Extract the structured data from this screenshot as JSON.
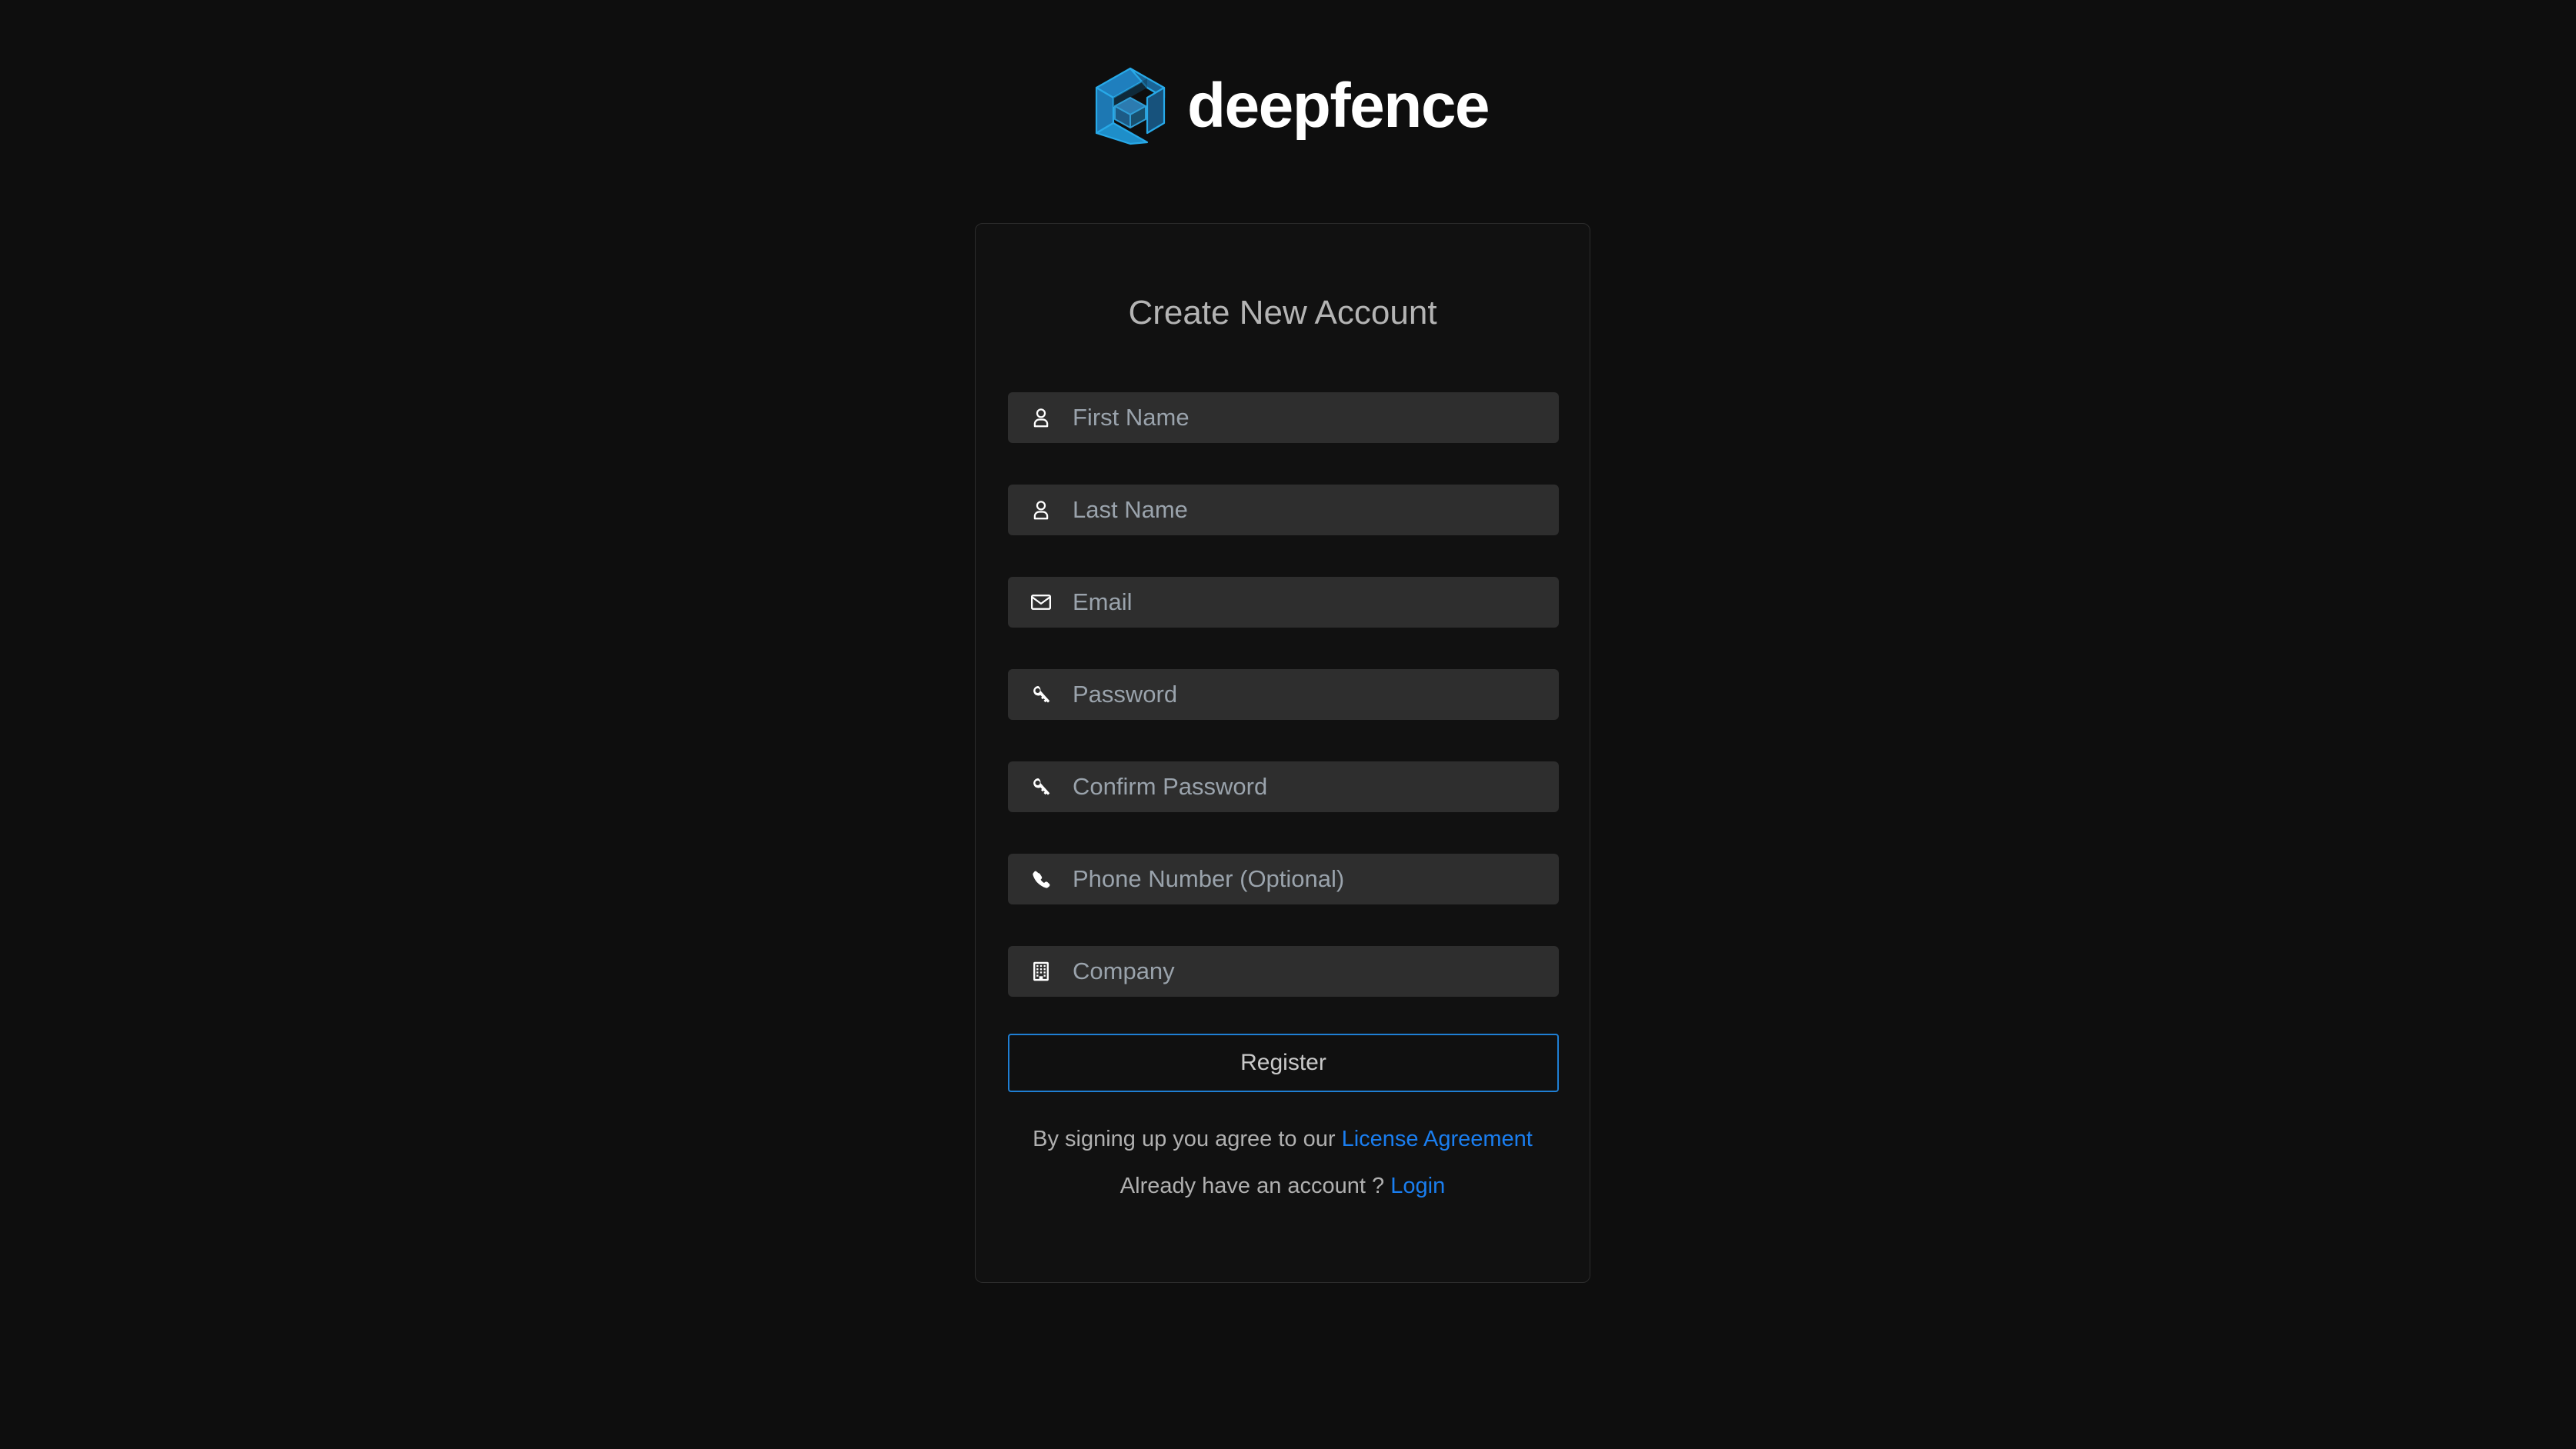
{
  "brand": {
    "name": "deepfence",
    "logo_icon": "deepfence-hexagon-cube-logo",
    "logo_colors": {
      "outer_light": "#1e9be0",
      "outer_mid": "#1f7fbe",
      "outer_dark": "#18567f",
      "inner_light": "#2c7bb0",
      "inner_dark": "#1d5b86"
    }
  },
  "card": {
    "title": "Create New Account"
  },
  "form": {
    "fields": [
      {
        "name": "first-name",
        "icon": "user-icon",
        "placeholder": "First Name",
        "value": "",
        "type": "text"
      },
      {
        "name": "last-name",
        "icon": "user-icon",
        "placeholder": "Last Name",
        "value": "",
        "type": "text"
      },
      {
        "name": "email",
        "icon": "envelope-icon",
        "placeholder": "Email",
        "value": "",
        "type": "email"
      },
      {
        "name": "password",
        "icon": "key-icon",
        "placeholder": "Password",
        "value": "",
        "type": "password"
      },
      {
        "name": "confirm-password",
        "icon": "key-icon",
        "placeholder": "Confirm Password",
        "value": "",
        "type": "password"
      },
      {
        "name": "phone-number",
        "icon": "phone-icon",
        "placeholder": "Phone Number (Optional)",
        "value": "",
        "type": "tel"
      },
      {
        "name": "company",
        "icon": "building-icon",
        "placeholder": "Company",
        "value": "",
        "type": "text"
      }
    ],
    "submit_label": "Register"
  },
  "footer": {
    "agreement_prefix": "By signing up you agree to our",
    "agreement_link": "License Agreement",
    "login_prefix": "Already have an account ?",
    "login_link": "Login"
  },
  "colors": {
    "page_background": "#0e0e0e",
    "card_background": "#111111",
    "card_border": "#2c2c2c",
    "input_background": "#2e2e2e",
    "accent_blue": "#1f7fd4",
    "link_blue": "#1a7ef0",
    "title_text": "#b4b4b4",
    "placeholder_text": "#9aa3ac"
  }
}
